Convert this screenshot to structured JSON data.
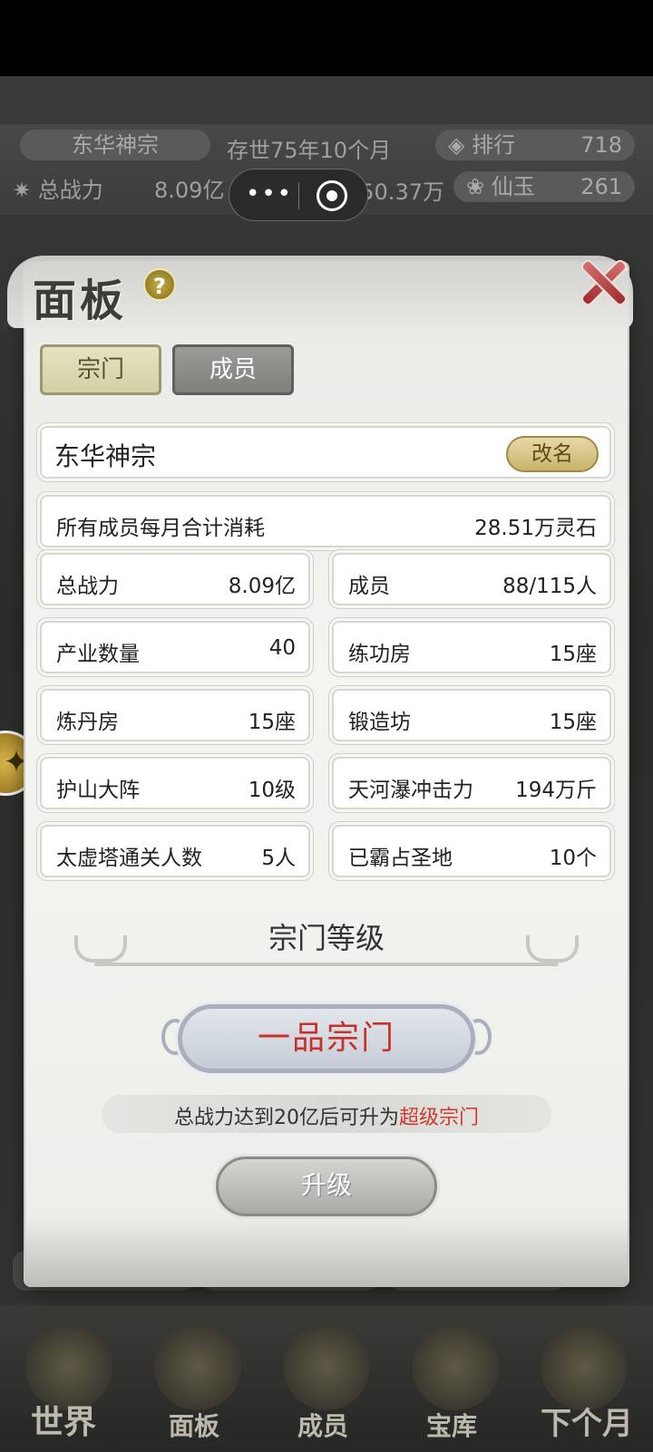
{
  "background": {
    "sect_name": "东华神宗",
    "age": "存世75年10个月",
    "rank_label": "排行",
    "rank_value": "718",
    "power_label": "总战力",
    "power_value": "8.09亿",
    "spirit_stone_value": "450.37万",
    "jade_label": "仙玉",
    "jade_value": "261",
    "nav": {
      "world": "世界",
      "panel": "面板",
      "members": "成员",
      "treasury": "宝库",
      "next_month": "下个月"
    }
  },
  "panel": {
    "title": "面板",
    "tabs": [
      {
        "label": "宗门",
        "active": true
      },
      {
        "label": "成员",
        "active": false
      }
    ],
    "sect_name": "东华神宗",
    "rename_label": "改名",
    "monthly_cost": {
      "label": "所有成员每月合计消耗",
      "value": "28.51万灵石"
    },
    "stats": [
      {
        "label": "总战力",
        "value": "8.09亿"
      },
      {
        "label": "成员",
        "value": "88/115人"
      },
      {
        "label": "产业数量",
        "value": "40"
      },
      {
        "label": "练功房",
        "value": "15座"
      },
      {
        "label": "炼丹房",
        "value": "15座"
      },
      {
        "label": "锻造坊",
        "value": "15座"
      },
      {
        "label": "护山大阵",
        "value": "10级"
      },
      {
        "label": "天河瀑冲击力",
        "value": "194万斤"
      },
      {
        "label": "太虚塔通关人数",
        "value": "5人"
      },
      {
        "label": "已霸占圣地",
        "value": "10个"
      }
    ],
    "level_section_title": "宗门等级",
    "current_rank": "一品宗门",
    "upgrade_hint_prefix": "总战力达到20亿后可升为",
    "upgrade_hint_target": "超级宗门",
    "upgrade_button": "升级"
  },
  "colors": {
    "accent_red": "#d23a2e",
    "tab_active": "#d3d0a6",
    "rename_gold": "#c9b36d"
  }
}
